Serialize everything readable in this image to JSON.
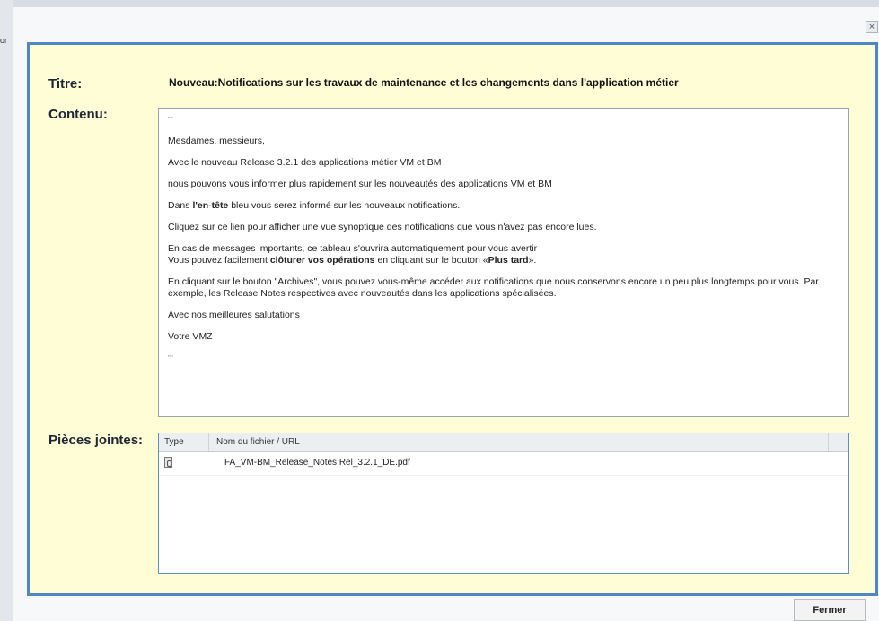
{
  "background": {
    "edge_text": "or"
  },
  "dialog": {
    "close_icon": "×",
    "titre_label": "Titre:",
    "titre_value": "Nouveau:Notifications sur les travaux de maintenance et les changements dans l'application métier",
    "contenu_label": "Contenu:",
    "content": {
      "quote_open": "\"\"",
      "greeting": "Mesdames, messieurs,",
      "p1": "Avec le nouveau Release 3.2.1 des applications métier VM et BM",
      "p2": "nous pouvons vous informer plus rapidement sur les nouveautés des applications VM et BM",
      "p3_pre": "Dans ",
      "p3_bold": "l'en-tête",
      "p3_post": " bleu vous serez informé sur les nouveaux notifications.",
      "p4": "Cliquez sur ce lien pour afficher une vue synoptique des notifications que vous n'avez pas encore lues.",
      "p5_line1": "En cas de messages importants, ce tableau s'ouvrira automatiquement pour vous avertir",
      "p5_line2_pre": "Vous pouvez facilement ",
      "p5_line2_bold": "clôturer vos opérations",
      "p5_line2_mid": " en cliquant sur le bouton «",
      "p5_line2_bold2": "Plus tard",
      "p5_line2_post": "».",
      "p6": "En cliquant sur le bouton \"Archives\", vous pouvez vous-même accéder aux notifications que nous conservons encore un peu plus longtemps pour vous. Par exemple, les Release Notes respectives avec nouveautés dans les applications spécialisées.",
      "p7": "Avec nos meilleures salutations",
      "p8": "Votre VMZ",
      "quote_close": "\"\""
    },
    "pieces_label": "Pièces jointes:",
    "attachments": {
      "col_type": "Type",
      "col_name": "Nom du fichier / URL",
      "rows": [
        {
          "icon": "pdf-file-icon",
          "name": "FA_VM-BM_Release_Notes Rel_3.2.1_DE.pdf"
        }
      ]
    },
    "close_button": "Fermer"
  }
}
